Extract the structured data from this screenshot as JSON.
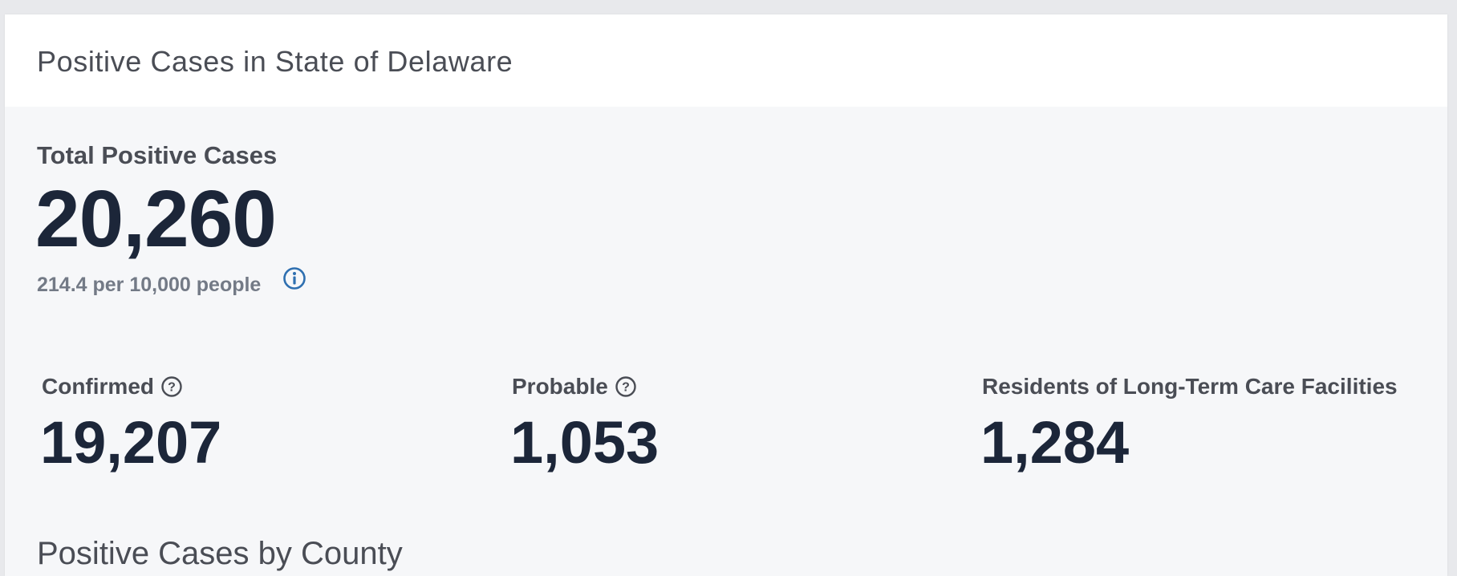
{
  "card": {
    "title": "Positive Cases in State of Delaware"
  },
  "total": {
    "label": "Total Positive Cases",
    "value": "20,260",
    "per_capita": "214.4 per 10,000 people",
    "info_icon": "info-icon"
  },
  "stats": {
    "confirmed": {
      "label": "Confirmed",
      "value": "19,207",
      "icon": "help-icon"
    },
    "probable": {
      "label": "Probable",
      "value": "1,053",
      "icon": "help-icon"
    },
    "ltc": {
      "label": "Residents of Long-Term Care Facilities",
      "value": "1,284"
    }
  },
  "next_section": {
    "title": "Positive Cases by County"
  },
  "colors": {
    "page_bg": "#e8e9ec",
    "header_bg": "#ffffff",
    "body_bg": "#f6f7f9",
    "title_text": "#4a4d55",
    "value_text": "#1c2639",
    "muted_text": "#737a86",
    "info_accent": "#2e6fb0"
  }
}
